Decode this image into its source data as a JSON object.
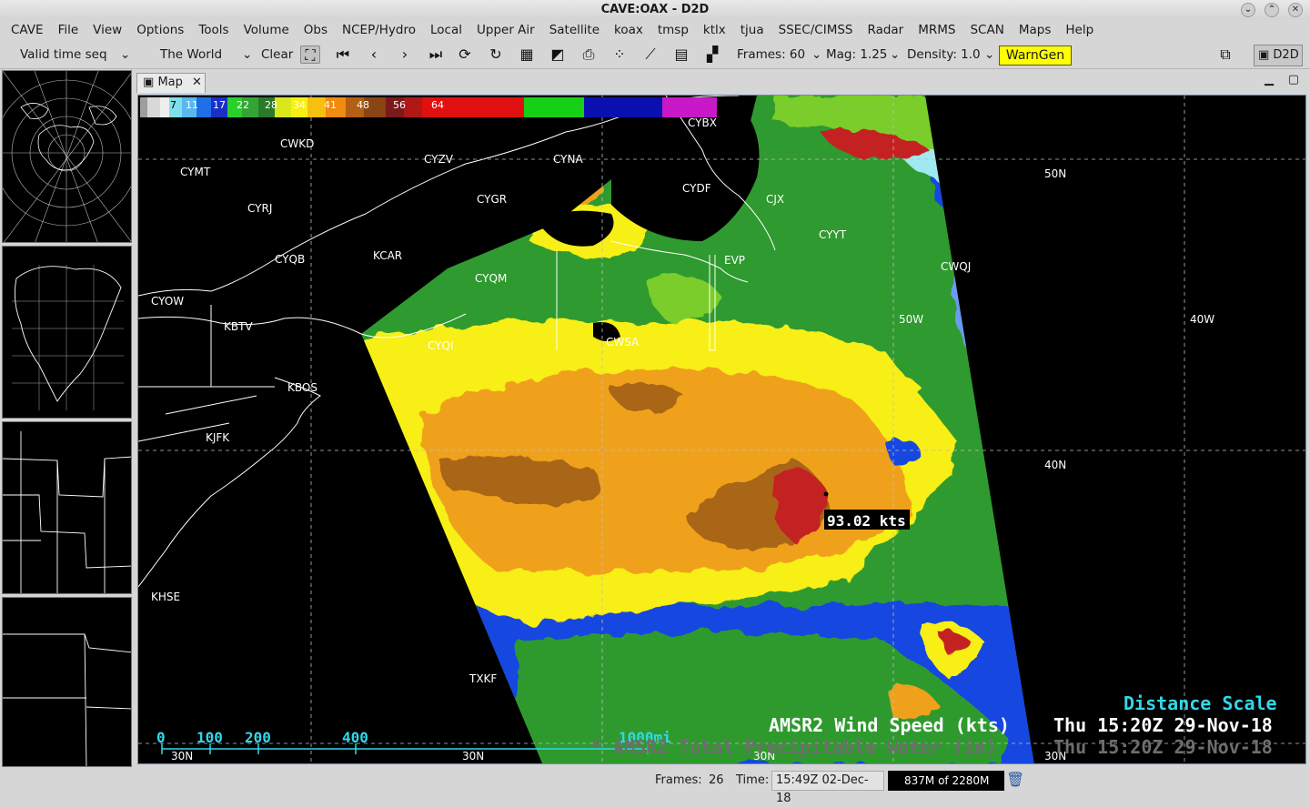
{
  "window": {
    "title": "CAVE:OAX - D2D"
  },
  "menu": [
    "CAVE",
    "File",
    "View",
    "Options",
    "Tools",
    "Volume",
    "Obs",
    "NCEP/Hydro",
    "Local",
    "Upper Air",
    "Satellite",
    "koax",
    "tmsp",
    "ktlx",
    "tjua",
    "SSEC/CIMSS",
    "Radar",
    "MRMS",
    "SCAN",
    "Maps",
    "Help"
  ],
  "toolbar": {
    "time_mode": "Valid time seq",
    "scale": "The World",
    "clear_label": "Clear",
    "frames_label": "Frames: 60",
    "mag_label": "Mag: 1.25",
    "density_label": "Density: 1.0",
    "warngen_label": "WarnGen",
    "perspective_label": "D2D",
    "colors": {
      "warngen_bg": "#ffff00"
    }
  },
  "editor_tab": {
    "label": "Map"
  },
  "colorbar": {
    "labels": [
      "7",
      "11",
      "17",
      "22",
      "28",
      "34",
      "41",
      "48",
      "56",
      "64"
    ]
  },
  "stations": [
    {
      "id": "CWKD"
    },
    {
      "id": "CYMT"
    },
    {
      "id": "CYRJ"
    },
    {
      "id": "CYZV"
    },
    {
      "id": "CYNA"
    },
    {
      "id": "CYQB"
    },
    {
      "id": "KCAR"
    },
    {
      "id": "CYGR"
    },
    {
      "id": "CYDF"
    },
    {
      "id": "CYBX"
    },
    {
      "id": "CYYT"
    },
    {
      "id": "CWQJ"
    },
    {
      "id": "CYQM"
    },
    {
      "id": "CYOW"
    },
    {
      "id": "KBTV"
    },
    {
      "id": "CYQI"
    },
    {
      "id": "CWSA"
    },
    {
      "id": "KBOS"
    },
    {
      "id": "KJFK"
    },
    {
      "id": "KHSE"
    },
    {
      "id": "TXKF"
    },
    {
      "id": "CJX"
    },
    {
      "id": "EVP"
    }
  ],
  "latlon_labels": [
    "50N",
    "40N",
    "50W",
    "40W",
    "30N",
    "30N",
    "30N",
    "30N"
  ],
  "sample_readout": "93.02 kts",
  "overlays": {
    "distance_scale_title": "Distance Scale",
    "scale_ticks": [
      "0",
      "100",
      "200",
      "400",
      "1000mi"
    ],
    "product_1": "AMSR2 Wind Speed (kts)",
    "product_1_time": "Thu 15:20Z 29-Nov-18",
    "product_2": "* AMSR2 Total Precipitable Water (in)",
    "product_2_time": "Thu 15:20Z 29-Nov-18"
  },
  "status": {
    "frames_label": "Frames:",
    "frames_value": "26",
    "time_label": "Time:",
    "time_value": "15:49Z 02-Dec-18",
    "memory": "837M of 2280M"
  }
}
